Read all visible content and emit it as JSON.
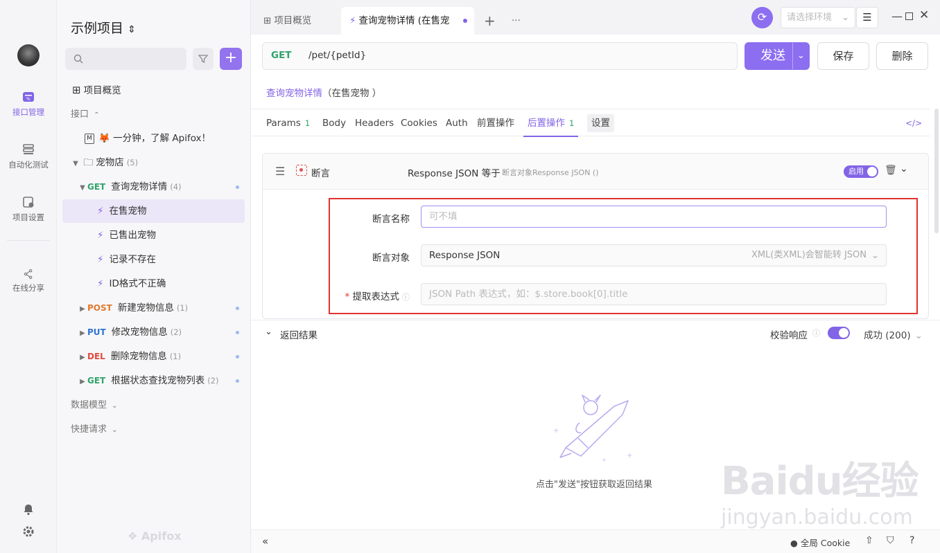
{
  "rail": {
    "items": [
      {
        "label": "接口管理",
        "icon": "api-management-icon",
        "active": true
      },
      {
        "label": "自动化测试",
        "icon": "automation-test-icon",
        "active": false
      },
      {
        "label": "项目设置",
        "icon": "project-settings-icon",
        "active": false
      },
      {
        "label": "在线分享",
        "icon": "share-icon",
        "active": false
      }
    ],
    "bottom_icons": [
      "bell-icon",
      "gear-icon"
    ]
  },
  "tree": {
    "project_title": "示例项目",
    "overview": "项目概览",
    "section_api": "接口",
    "intro_doc": "🦊 一分钟，了解 Apifox！",
    "folder": {
      "name": "宠物店",
      "count": "(5)"
    },
    "endpoints": [
      {
        "method": "GET",
        "name": "查询宠物详情",
        "count": "(4)",
        "expanded": true,
        "cases": [
          "在售宠物",
          "已售出宠物",
          "记录不存在",
          "ID格式不正确"
        ]
      },
      {
        "method": "POST",
        "name": "新建宠物信息",
        "count": "(1)"
      },
      {
        "method": "PUT",
        "name": "修改宠物信息",
        "count": "(2)"
      },
      {
        "method": "DEL",
        "name": "删除宠物信息",
        "count": "(1)"
      },
      {
        "method": "GET",
        "name": "根据状态查找宠物列表",
        "count": "(2)"
      }
    ],
    "section_models": "数据模型",
    "section_quick": "快捷请求",
    "footer_logo": "Apifox"
  },
  "tabs": {
    "overview": "项目概览",
    "active": "查询宠物详情 (在售宠",
    "env_placeholder": "请选择环境"
  },
  "request": {
    "method": "GET",
    "path": "/pet/{petId}",
    "send": "发送",
    "save": "保存",
    "delete": "删除",
    "breadcrumb_link": "查询宠物详情",
    "breadcrumb_case": "（在售宠物 ）"
  },
  "subtabs": {
    "params": "Params",
    "params_count": "1",
    "body": "Body",
    "headers": "Headers",
    "cookies": "Cookies",
    "auth": "Auth",
    "pre": "前置操作",
    "post": "后置操作",
    "post_count": "1",
    "settings": "设置"
  },
  "assertion": {
    "title": "断言",
    "summary": "Response JSON 等于",
    "summary_detail": "断言对象Response JSON ()",
    "enabled_label": "启用",
    "name_label": "断言名称",
    "name_placeholder": "可不填",
    "target_label": "断言对象",
    "target_value": "Response JSON",
    "target_hint": "XML(类XML)会智能转 JSON",
    "expr_label": "提取表达式",
    "expr_placeholder": "JSON Path 表达式，如：$.store.book[0].title"
  },
  "result": {
    "title": "返回结果",
    "validate_label": "校验响应",
    "status": "成功 (200)",
    "empty_hint": "点击\"发送\"按钮获取返回结果"
  },
  "bottom": {
    "cookie_label": "全局 Cookie"
  },
  "watermark": {
    "brand": "Baidu经验",
    "url": "jingyan.baidu.com"
  },
  "colors": {
    "accent": "#8264e6",
    "get": "#2fa36b",
    "post": "#e07a2c",
    "put": "#2f74d0",
    "del": "#e0493c",
    "highlight_box": "#e0322d"
  }
}
